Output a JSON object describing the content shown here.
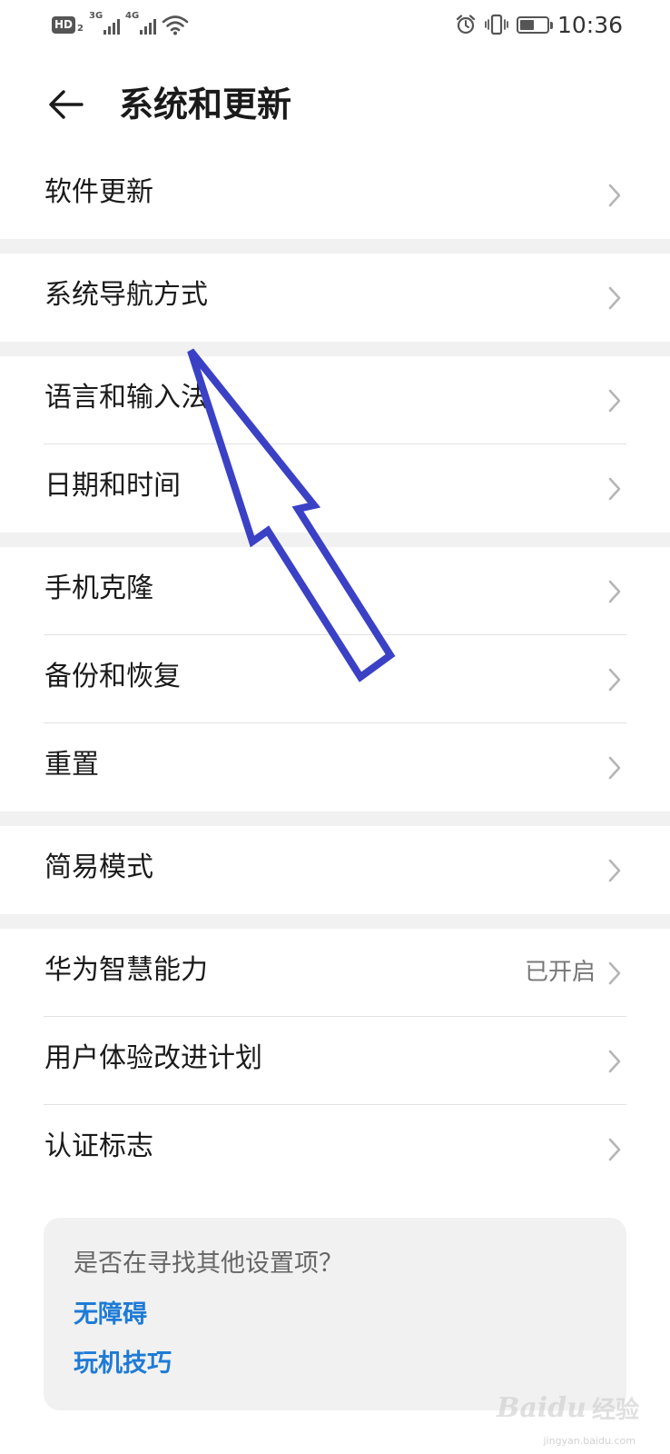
{
  "status_bar": {
    "hd_label": "HD",
    "hd_sub": "2",
    "network1": "3G",
    "network2": "4G",
    "time": "10:36",
    "icons": [
      "signal-icon",
      "wifi-icon",
      "alarm-icon",
      "vibrate-icon",
      "battery-icon"
    ]
  },
  "header": {
    "title": "系统和更新",
    "back_icon": "back-arrow-icon"
  },
  "sections": [
    {
      "items": [
        {
          "label": "软件更新",
          "value": ""
        }
      ]
    },
    {
      "items": [
        {
          "label": "系统导航方式",
          "value": ""
        }
      ]
    },
    {
      "items": [
        {
          "label": "语言和输入法",
          "value": ""
        },
        {
          "label": "日期和时间",
          "value": ""
        }
      ]
    },
    {
      "items": [
        {
          "label": "手机克隆",
          "value": ""
        },
        {
          "label": "备份和恢复",
          "value": ""
        },
        {
          "label": "重置",
          "value": ""
        }
      ]
    },
    {
      "items": [
        {
          "label": "简易模式",
          "value": ""
        }
      ]
    },
    {
      "items": [
        {
          "label": "华为智慧能力",
          "value": "已开启"
        },
        {
          "label": "用户体验改进计划",
          "value": ""
        },
        {
          "label": "认证标志",
          "value": ""
        }
      ]
    }
  ],
  "suggestions": {
    "question": "是否在寻找其他设置项？",
    "links": [
      "无障碍",
      "玩机技巧"
    ]
  },
  "annotation": {
    "color": "#3b41c5",
    "icon": "pointer-arrow-icon"
  },
  "watermark": {
    "logo": "Baidu",
    "text": "经验",
    "sub": "jingyan.baidu.com"
  },
  "colors": {
    "link": "#1e7bd6",
    "section_gap": "#f1f1f1",
    "divider": "#e2e2e2"
  }
}
